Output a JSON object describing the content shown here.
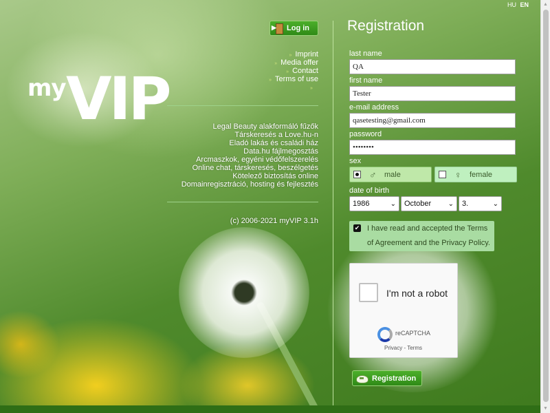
{
  "header": {
    "languages": [
      {
        "code": "HU",
        "active": false
      },
      {
        "code": "EN",
        "active": true
      }
    ],
    "login_label": "Log in"
  },
  "logo": {
    "my": "my",
    "vip": "VIP"
  },
  "nav": {
    "items": [
      "Imprint",
      "Media offer",
      "Contact",
      "Terms of use",
      ""
    ]
  },
  "partner_links": [
    "Legal Beauty alakformáló fűzők",
    "Társkeresés a Love.hu-n",
    "Eladó lakás és családi ház",
    "Data.hu fájlmegosztás",
    "Arcmaszkok, egyéni védőfelszerelés",
    "Online chat, társkeresés, beszélgetés",
    "Kötelező biztosítás online",
    "Domainregisztráció, hosting és fejlesztés"
  ],
  "copyright": "(c) 2006-2021 myVIP 3.1h",
  "registration": {
    "title": "Registration",
    "last_name": {
      "label": "last name",
      "value": "QA"
    },
    "first_name": {
      "label": "first name",
      "value": "Tester"
    },
    "email": {
      "label": "e-mail address",
      "value": "qasetesting@gmail.com"
    },
    "password": {
      "label": "password",
      "value": "••••••••"
    },
    "sex": {
      "label": "sex",
      "options": [
        {
          "label": "male",
          "selected": true,
          "icon": "male-symbol-icon"
        },
        {
          "label": "female",
          "selected": false,
          "icon": "female-symbol-icon"
        }
      ]
    },
    "dob": {
      "label": "date of birth",
      "year": "1986",
      "month": "October",
      "day": "3."
    },
    "terms": {
      "checked": true,
      "line1": "I have read and accepted the Terms",
      "line2": "of Agreement and the Privacy Policy."
    },
    "captcha": {
      "label": "I'm not a robot",
      "brand": "reCAPTCHA",
      "privacy": "Privacy",
      "sep": " - ",
      "terms": "Terms"
    },
    "submit_label": "Registration"
  },
  "colors": {
    "button_green": "#2f8a17",
    "male_bg": "#bfe8a9",
    "female_bg": "#bff0bf",
    "terms_bg": "#a9dca2",
    "bottom_bar": "#2f6e16"
  }
}
